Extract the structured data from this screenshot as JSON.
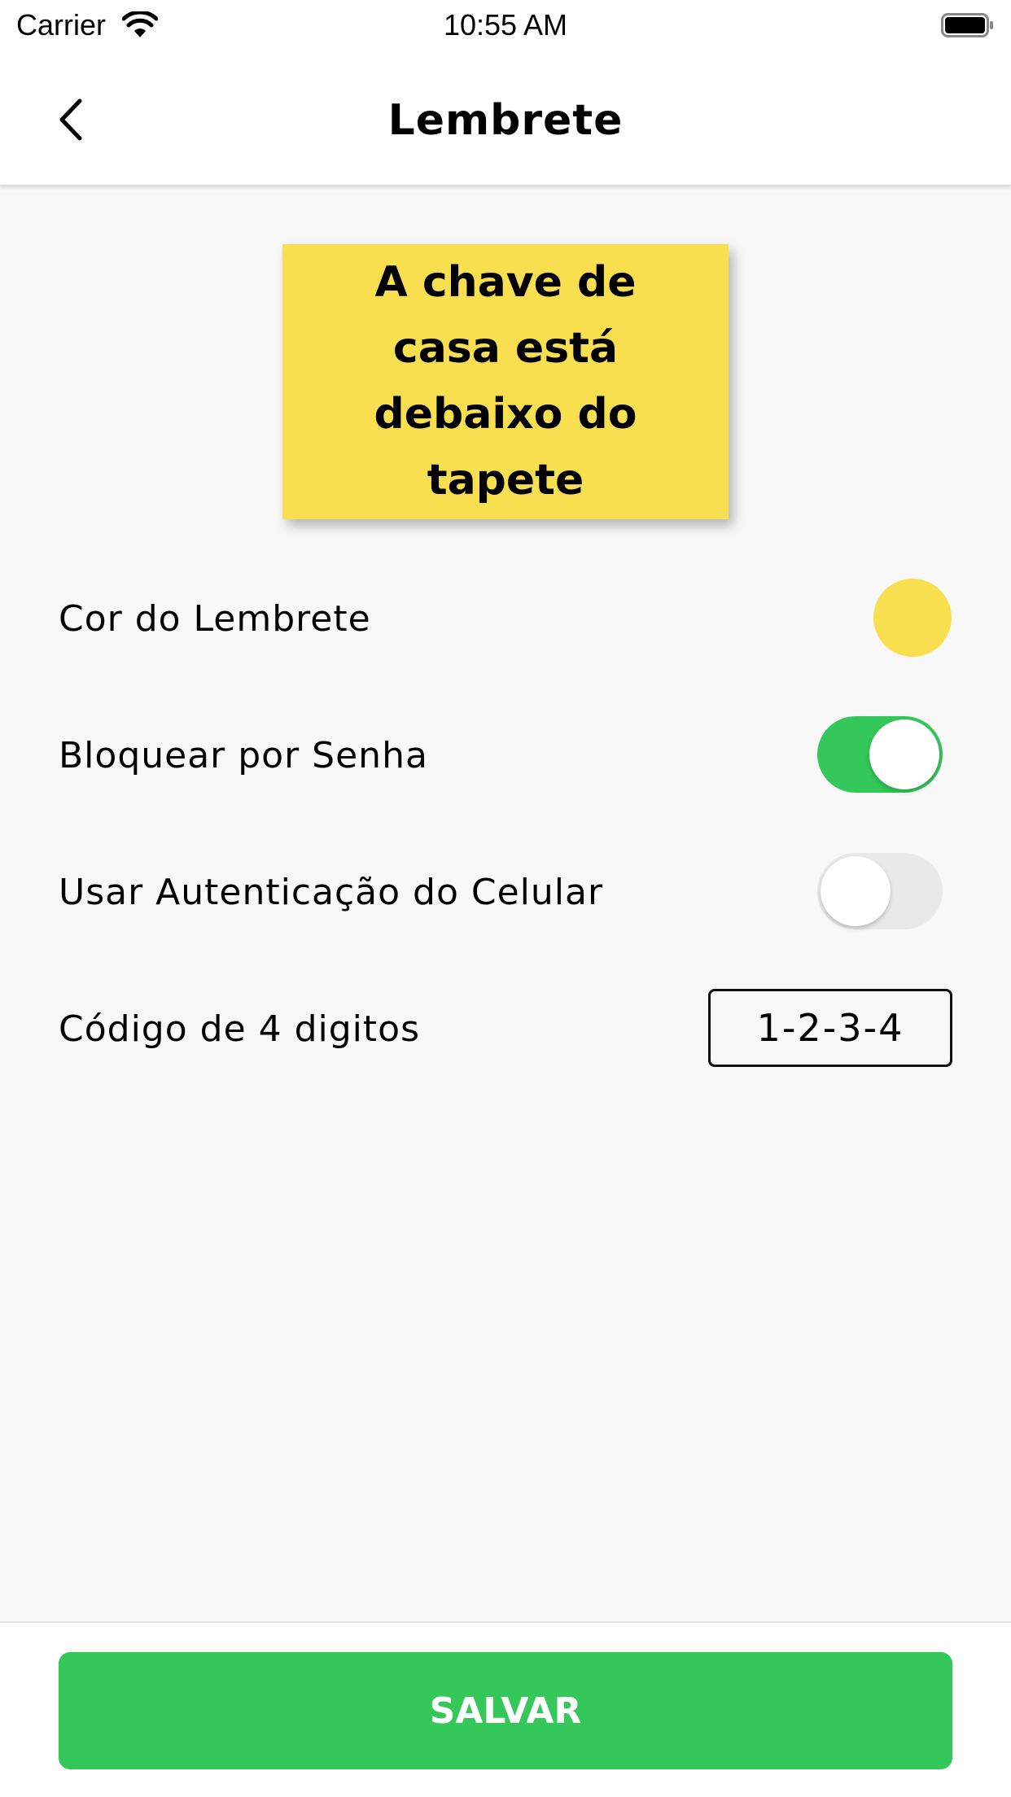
{
  "status_bar": {
    "carrier": "Carrier",
    "time": "10:55 AM",
    "icons": [
      "wifi-icon",
      "battery-icon"
    ]
  },
  "nav": {
    "title": "Lembrete",
    "back_icon": "chevron-left-icon"
  },
  "note": {
    "text": "A chave de casa está debaixo do tapete",
    "color": "#f8df4f"
  },
  "settings": {
    "color_label": "Cor do Lembrete",
    "color_value": "#f8df4f",
    "lock_label": "Bloquear por Senha",
    "lock_enabled": true,
    "auth_label": "Usar Autenticação do Celular",
    "auth_enabled": false,
    "code_label": "Código de 4 digitos",
    "code_value": "1-2-3-4"
  },
  "footer": {
    "save_label": "SALVAR",
    "accent": "#34c759"
  }
}
